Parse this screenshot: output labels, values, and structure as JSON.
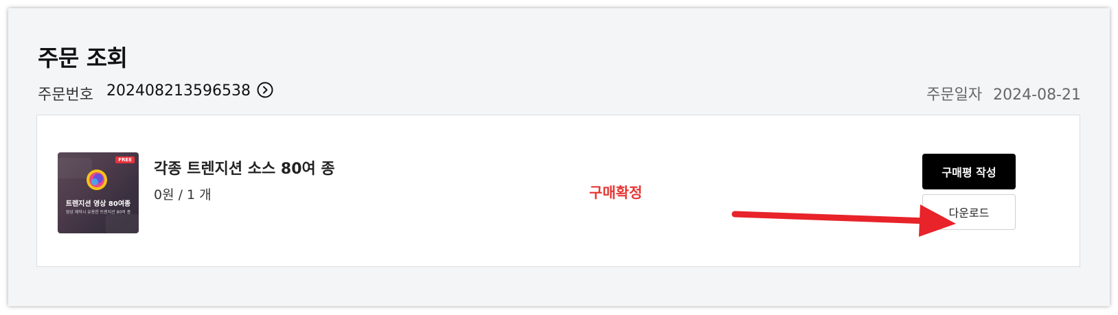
{
  "page": {
    "title": "주문 조회"
  },
  "order": {
    "number_label": "주문번호",
    "number": "202408213596538",
    "date_label": "주문일자",
    "date": "2024-08-21"
  },
  "item": {
    "thumbnail": {
      "badge": "FREE",
      "title": "트렌지션 영상 80여종",
      "subtitle": "영상 제작시 유용한 트렌지션 80여 종"
    },
    "name": "각종 트렌지션 소스 80여 종",
    "price_quantity": "0원 / 1 개",
    "status": "구매확정",
    "status_color": "#e53935"
  },
  "actions": {
    "review_label": "구매평 작성",
    "download_label": "다운로드"
  },
  "icons": {
    "order_link": "circle-chevron-right-icon",
    "thumbnail_logo": "circular-logo-icon"
  },
  "annotation": {
    "arrow_color": "#e8232a"
  }
}
